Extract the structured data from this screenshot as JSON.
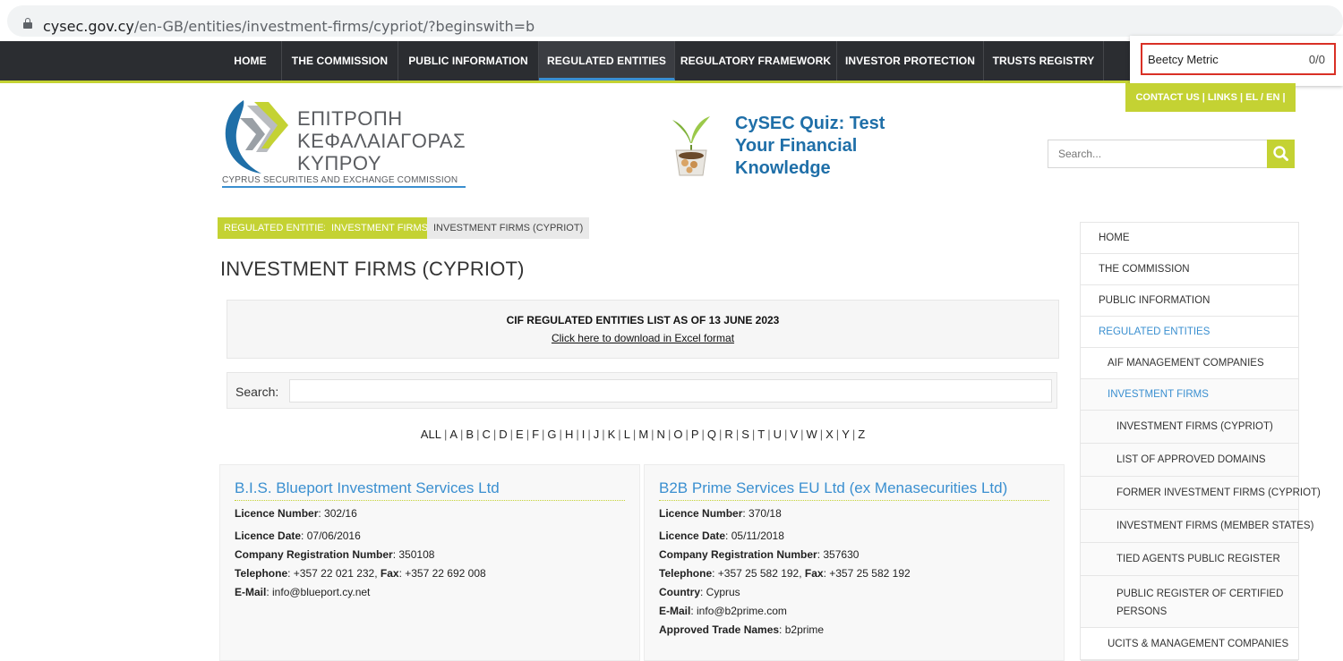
{
  "browser": {
    "url_host": "cysec.gov.cy",
    "url_path": "/en-GB/entities/investment-firms/cypriot/?beginswith=b"
  },
  "topnav": {
    "items": [
      "HOME",
      "THE COMMISSION",
      "PUBLIC INFORMATION",
      "REGULATED ENTITIES",
      "REGULATORY FRAMEWORK",
      "INVESTOR PROTECTION",
      "TRUSTS REGISTRY"
    ],
    "active": "REGULATED ENTITIES"
  },
  "extension": {
    "name": "Beetcy Metric",
    "count": "0/0"
  },
  "contact_bar": "CONTACT US  |  LINKS  |   EL / EN  |",
  "logo": {
    "greek_line1": "ΕΠΙΤΡΟΠΗ",
    "greek_line2": "ΚΕΦΑΛΑΙΑΓΟΡΑΣ",
    "greek_line3": "ΚΥΠΡΟΥ",
    "english": "CYPRUS SECURITIES AND EXCHANGE COMMISSION"
  },
  "quiz": {
    "line1": "CySEC Quiz: Test",
    "line2": "Your Financial",
    "line3": "Knowledge"
  },
  "header_search": {
    "placeholder": "Search..."
  },
  "breadcrumb": [
    "REGULATED ENTITIES",
    "INVESTMENT FIRMS",
    "INVESTMENT FIRMS (CYPRIOT)"
  ],
  "page_title": "INVESTMENT FIRMS (CYPRIOT)",
  "info": {
    "title": "CIF REGULATED ENTITIES LIST AS OF 13 JUNE 2023",
    "link": "Click here to download in Excel format"
  },
  "search": {
    "label": "Search:",
    "value": ""
  },
  "alphabet": [
    "ALL",
    "A",
    "B",
    "C",
    "D",
    "E",
    "F",
    "G",
    "H",
    "I",
    "J",
    "K",
    "L",
    "M",
    "N",
    "O",
    "P",
    "Q",
    "R",
    "S",
    "T",
    "U",
    "V",
    "W",
    "X",
    "Y",
    "Z"
  ],
  "firms": [
    {
      "name": "B.I.S. Blueport Investment Services Ltd",
      "rows": [
        {
          "label": "Licence Number",
          "value": "302/16"
        },
        {
          "label": "Licence Date",
          "value": "07/06/2016"
        },
        {
          "label": "Company Registration Number",
          "value": "350108"
        },
        {
          "label": "Telephone",
          "value": "+357 22 021 232",
          "label2": "Fax",
          "value2": "+357 22 692 008"
        },
        {
          "label": "E-Mail",
          "value": "info@blueport.cy.net"
        }
      ]
    },
    {
      "name": "B2B Prime Services EU Ltd (ex Menasecurities Ltd)",
      "rows": [
        {
          "label": "Licence Number",
          "value": "370/18"
        },
        {
          "label": "Licence Date",
          "value": "05/11/2018"
        },
        {
          "label": "Company Registration Number",
          "value": "357630"
        },
        {
          "label": "Telephone",
          "value": "+357 25 582 192",
          "label2": "Fax",
          "value2": "+357 25 582 192"
        },
        {
          "label": "Country",
          "value": "Cyprus"
        },
        {
          "label": "E-Mail",
          "value": "info@b2prime.com"
        },
        {
          "label": "Approved Trade Names",
          "value": "b2prime"
        }
      ]
    }
  ],
  "sidebar": {
    "items": [
      {
        "label": "HOME",
        "level": 0,
        "active": false
      },
      {
        "label": "THE COMMISSION",
        "level": 0,
        "active": false
      },
      {
        "label": "PUBLIC INFORMATION",
        "level": 0,
        "active": false
      },
      {
        "label": "REGULATED ENTITIES",
        "level": 0,
        "active": true
      },
      {
        "label": "AIF MANAGEMENT COMPANIES",
        "level": 1,
        "active": false
      },
      {
        "label": "INVESTMENT FIRMS",
        "level": 1,
        "active": true
      },
      {
        "label": "INVESTMENT FIRMS (CYPRIOT)",
        "level": 2,
        "active": false
      },
      {
        "label": "LIST OF APPROVED DOMAINS",
        "level": 2,
        "active": false
      },
      {
        "label": "FORMER INVESTMENT FIRMS (CYPRIOT)",
        "level": 2,
        "active": false
      },
      {
        "label": "INVESTMENT FIRMS (MEMBER STATES)",
        "level": 2,
        "active": false
      },
      {
        "label": "TIED AGENTS PUBLIC REGISTER",
        "level": 2,
        "active": false
      },
      {
        "label": "PUBLIC REGISTER OF CERTIFIED PERSONS",
        "level": 2,
        "active": false
      },
      {
        "label": "UCITS & MANAGEMENT COMPANIES",
        "level": 1,
        "active": false
      }
    ]
  },
  "colors": {
    "accent_green": "#c4d233",
    "link_blue": "#3a8fd0",
    "nav_dark": "#2b2d31"
  }
}
